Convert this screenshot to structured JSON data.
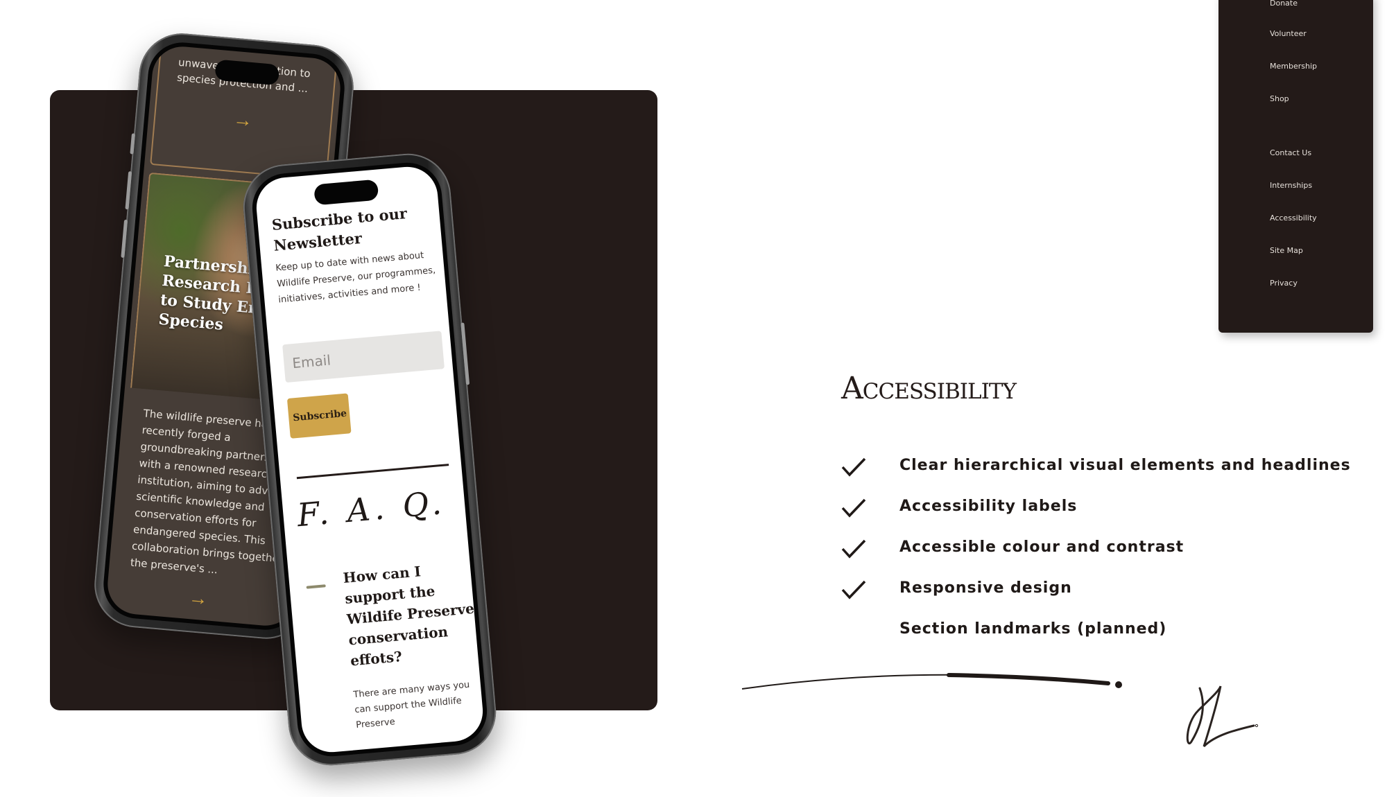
{
  "back_phone": {
    "top_excerpt": "unwavering dedication to species protection and ...",
    "article_title": "Partnership with Research Institute to Study Endangered Species",
    "article_body": "The wildlife preserve has recently forged a groundbreaking partnership with a renowned research institution, aiming to advance scientific knowledge and conservation efforts for endangered species. This collaboration brings together the preserve's ...",
    "arrow_icon": "→"
  },
  "front_phone": {
    "newsletter_title": "Subscribe to our Newsletter",
    "newsletter_description": "Keep up to date with news about Wildlife Preserve, our programmes, initiatives, activities and more !",
    "email_placeholder": "Email",
    "subscribe_label": "Subscribe",
    "faq_title": "F. A. Q.",
    "faq_question": "How can I support the Wildife Preserve conservation effots?",
    "faq_answer": "There are many ways you can support the Wildlife Preserve"
  },
  "footer_nav": {
    "items": [
      "Donate",
      "Volunteer",
      "Membership",
      "Shop",
      "Contact Us",
      "Internships",
      "Accessibility",
      "Site Map",
      "Privacy"
    ]
  },
  "accessibility": {
    "heading": "Accessibility",
    "items": [
      {
        "label": "Clear hierarchical visual elements and headlines",
        "checked": true
      },
      {
        "label": "Accessibility labels",
        "checked": true
      },
      {
        "label": "Accessible colour and contrast",
        "checked": true
      },
      {
        "label": "Responsive design",
        "checked": true
      },
      {
        "label": "Section landmarks (planned)",
        "checked": false
      }
    ]
  },
  "colors": {
    "dark_brown": "#241b19",
    "card_brown": "#463d37",
    "gold_accent": "#cfa44a",
    "card_border": "#a07c52",
    "faq_dash": "#8d8a6c"
  }
}
